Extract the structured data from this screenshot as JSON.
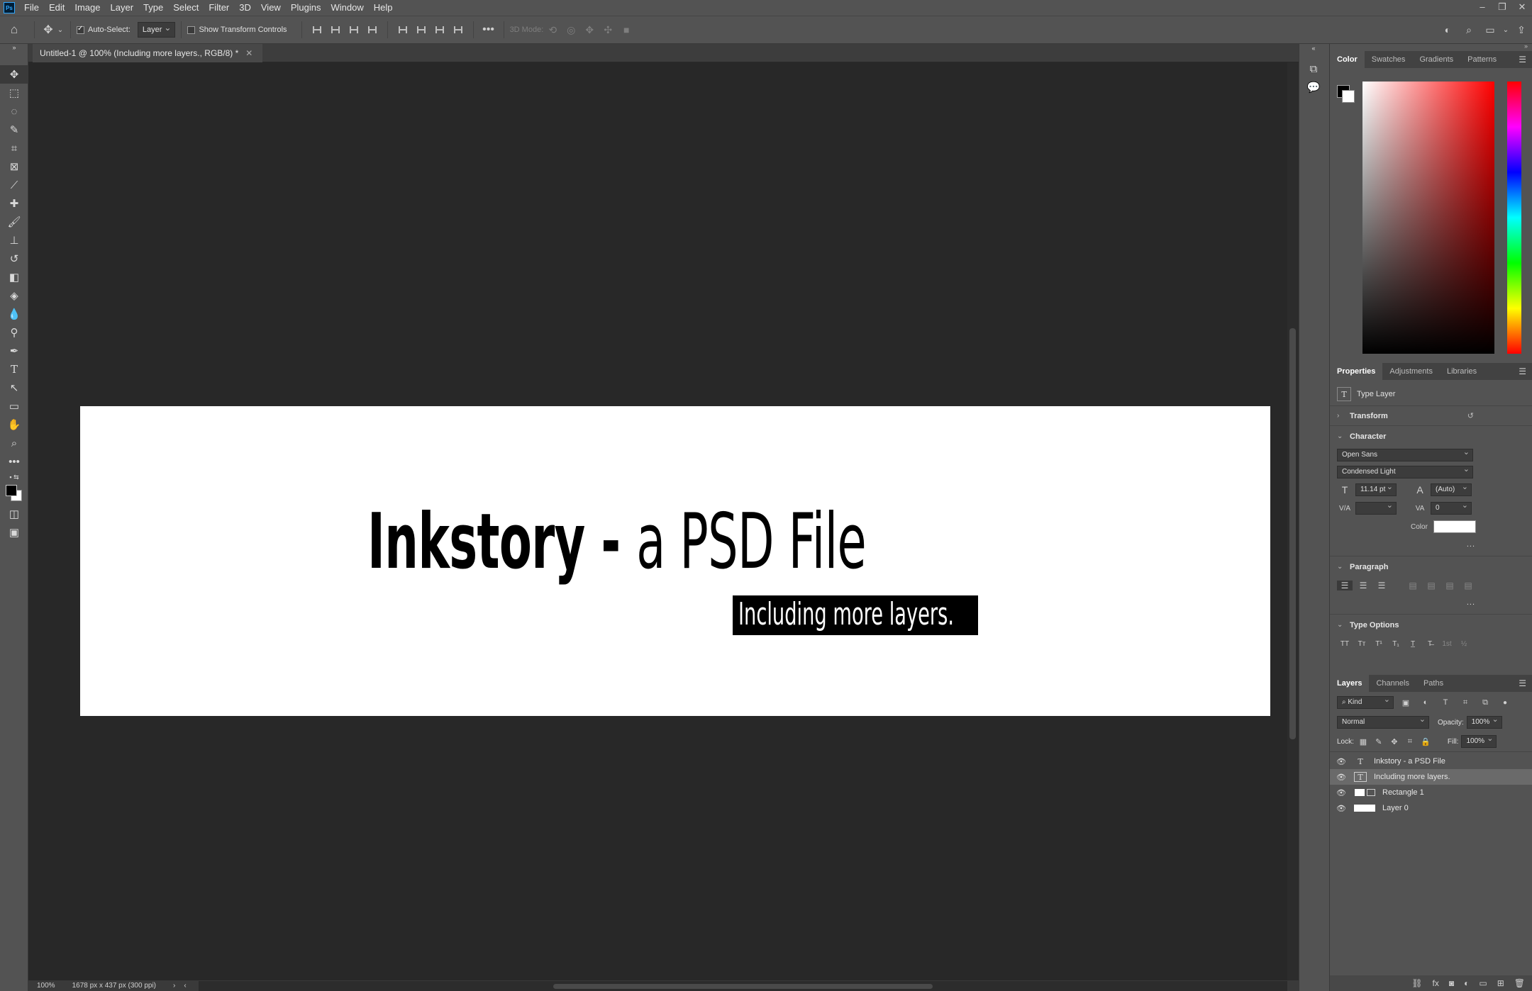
{
  "app": {
    "logo": "Ps"
  },
  "menu": [
    "File",
    "Edit",
    "Image",
    "Layer",
    "Type",
    "Select",
    "Filter",
    "3D",
    "View",
    "Plugins",
    "Window",
    "Help"
  ],
  "options": {
    "auto_select_label": "Auto-Select:",
    "auto_select_checked": true,
    "auto_select_value": "Layer",
    "transform_controls_label": "Show Transform Controls",
    "transform_controls_checked": false,
    "mode_3d_label": "3D Mode:"
  },
  "document": {
    "tab_title": "Untitled-1 @ 100% (Including more layers., RGB/8) *",
    "headline_bold": "Inkstory - ",
    "headline_light": "a PSD File",
    "subtitle": "Including more layers.",
    "zoom": "100%",
    "dimensions": "1678 px x 437 px (300 ppi)"
  },
  "color_panel": {
    "tabs": [
      "Color",
      "Swatches",
      "Gradients",
      "Patterns"
    ],
    "active_tab": "Color"
  },
  "properties_panel": {
    "tabs": [
      "Properties",
      "Adjustments",
      "Libraries"
    ],
    "layer_type": "Type Layer",
    "transform_label": "Transform",
    "character_label": "Character",
    "font_family": "Open Sans",
    "font_style": "Condensed Light",
    "font_size": "11.14 pt",
    "leading": "(Auto)",
    "kerning": "",
    "tracking": "0",
    "color_label": "Color",
    "text_color": "#ffffff",
    "paragraph_label": "Paragraph",
    "type_options_label": "Type Options",
    "more": "..."
  },
  "layers_panel": {
    "tabs": [
      "Layers",
      "Channels",
      "Paths"
    ],
    "filter_kind": "Kind",
    "blend_mode": "Normal",
    "opacity_label": "Opacity:",
    "opacity_value": "100%",
    "lock_label": "Lock:",
    "fill_label": "Fill:",
    "fill_value": "100%",
    "layers": [
      {
        "name": "Inkstory - a PSD File",
        "kind": "text",
        "selected": false
      },
      {
        "name": "Including more layers.",
        "kind": "text",
        "selected": true
      },
      {
        "name": "Rectangle 1",
        "kind": "shape",
        "selected": false
      },
      {
        "name": "Layer 0",
        "kind": "pixel",
        "selected": false
      }
    ]
  }
}
